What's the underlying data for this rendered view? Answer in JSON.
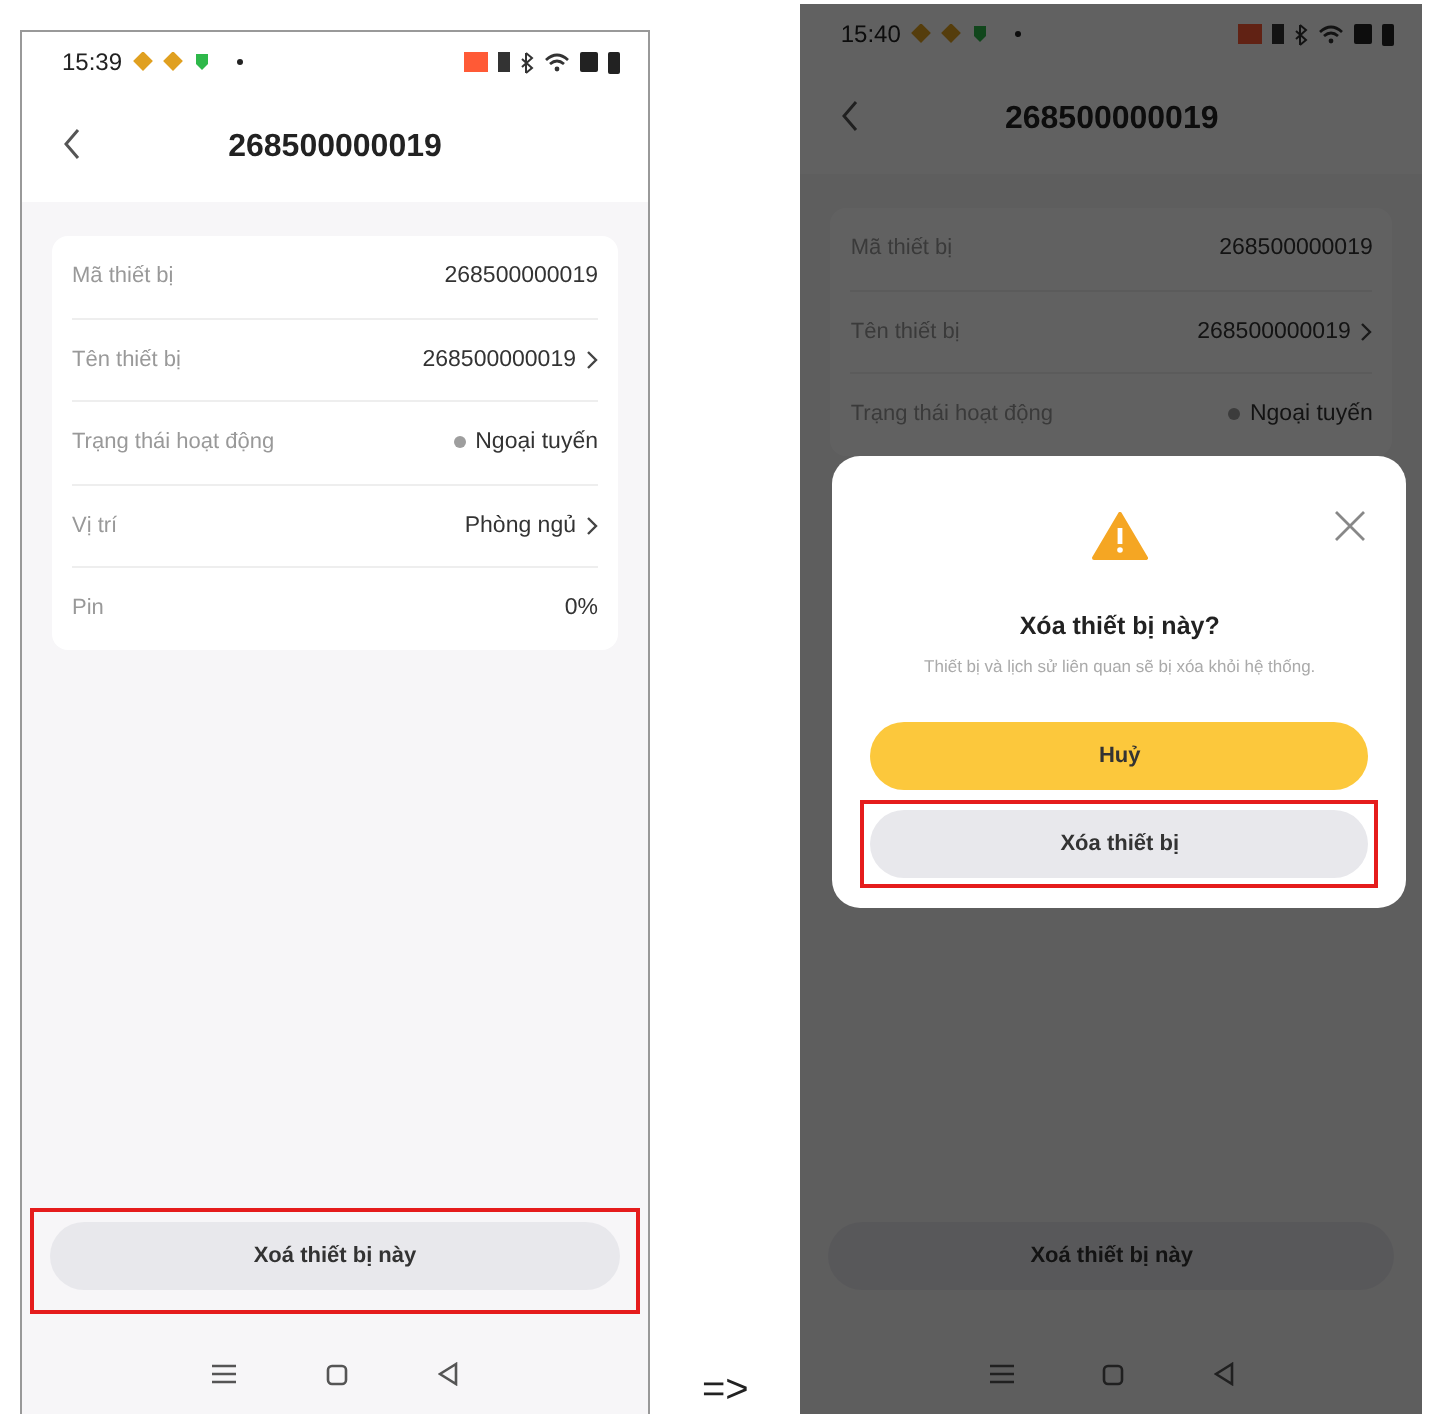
{
  "screens": [
    {
      "status_time": "15:39",
      "title": "268500000019",
      "rows": [
        {
          "kind": "plain",
          "label": "Mã thiết bị",
          "value": "268500000019"
        },
        {
          "kind": "link",
          "label": "Tên thiết bị",
          "value": "268500000019"
        },
        {
          "kind": "status",
          "label": "Trạng thái hoạt động",
          "value": "Ngoại tuyến",
          "color": "#9e9e9e"
        },
        {
          "kind": "link",
          "label": "Vị trí",
          "value": "Phòng ngủ"
        },
        {
          "kind": "plain",
          "label": "Pin",
          "value": "0%"
        }
      ],
      "delete_button": {
        "label": "Xoá thiết bị này",
        "highlighted": true
      }
    },
    {
      "status_time": "15:40",
      "title": "268500000019",
      "rows": [
        {
          "kind": "plain",
          "label": "Mã thiết bị",
          "value": "268500000019"
        },
        {
          "kind": "link",
          "label": "Tên thiết bị",
          "value": "268500000019"
        },
        {
          "kind": "status",
          "label": "Trạng thái hoạt động",
          "value": "Ngoại tuyến",
          "color": "#3c3c3c"
        }
      ],
      "delete_button": {
        "label": "Xoá thiết bị này",
        "highlighted": false
      },
      "dialog": {
        "title": "Xóa thiết bị này?",
        "message": "Thiết bị và lịch sử liên quan sẽ bị xóa khỏi hệ thống.",
        "buttons": [
          {
            "kind": "primary",
            "label": "Huỷ",
            "highlighted": false
          },
          {
            "kind": "secondary",
            "label": "Xóa thiết bị",
            "highlighted": true
          }
        ]
      }
    }
  ],
  "transition_label": "=>"
}
